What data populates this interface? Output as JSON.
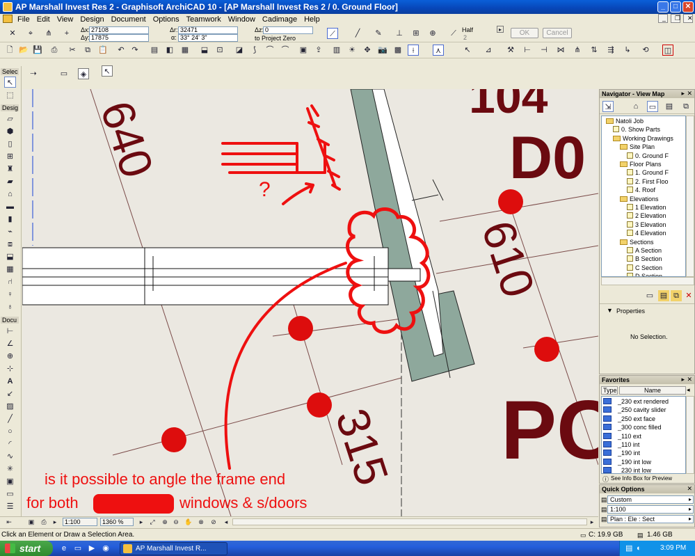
{
  "window": {
    "title": "AP Marshall Invest Res 2 - Graphisoft ArchiCAD 10 - [AP Marshall Invest Res 2 / 0. Ground Floor]",
    "controls": [
      "_",
      "□",
      "✕"
    ]
  },
  "menu": [
    "File",
    "Edit",
    "View",
    "Design",
    "Document",
    "Options",
    "Teamwork",
    "Window",
    "Cadimage",
    "Help"
  ],
  "coords": {
    "dx_label": "Δx:",
    "dx": "27108",
    "dy_label": "Δy:",
    "dy": "17875",
    "dr_label": "Δr:",
    "dr": "32471",
    "da_label": "α:",
    "da": "33° 24' 3\"",
    "dz_label": "Δz:",
    "dz": "0",
    "zero": "to Project Zero",
    "half_label": "Half",
    "half_value": "2",
    "ok": "OK",
    "cancel": "Cancel"
  },
  "toolbox": {
    "select_header": "Selec",
    "design_header": "Desig",
    "document_header": "Docu"
  },
  "canvas": {
    "dims": [
      "640",
      "610",
      "315",
      "104",
      "D0",
      "PC"
    ],
    "question_mark": "?",
    "annotation_line1": "is it possible to angle the frame end",
    "annotation_line2_prefix": "for both",
    "annotation_line2_suffix": "windows & s/doors",
    "colors": {
      "dim_text": "#6b0a10",
      "annotation": "#ee1010",
      "wall": "#8da59b",
      "marker": "#dd0d0d"
    }
  },
  "bottom_controls": {
    "scale": "1:100",
    "zoom": "1360 %"
  },
  "navigator": {
    "title": "Navigator - View Map",
    "tree": [
      {
        "label": "Natoli Job",
        "kind": "root",
        "level": 0
      },
      {
        "label": "0. Show Parts",
        "kind": "doc",
        "level": 1
      },
      {
        "label": "Working Drawings",
        "kind": "folder",
        "level": 1
      },
      {
        "label": "Site Plan",
        "kind": "folder",
        "level": 2
      },
      {
        "label": "0. Ground F",
        "kind": "doc",
        "level": 3
      },
      {
        "label": "Floor Plans",
        "kind": "folder",
        "level": 2
      },
      {
        "label": "1. Ground F",
        "kind": "doc",
        "level": 3
      },
      {
        "label": "2. First Floo",
        "kind": "doc",
        "level": 3
      },
      {
        "label": "4. Roof",
        "kind": "doc",
        "level": 3
      },
      {
        "label": "Elevations",
        "kind": "folder",
        "level": 2
      },
      {
        "label": "1 Elevation",
        "kind": "doc",
        "level": 3
      },
      {
        "label": "2 Elevation",
        "kind": "doc",
        "level": 3
      },
      {
        "label": "3 Elevation",
        "kind": "doc",
        "level": 3
      },
      {
        "label": "4 Elevation",
        "kind": "doc",
        "level": 3
      },
      {
        "label": "Sections",
        "kind": "folder",
        "level": 2
      },
      {
        "label": "A Section",
        "kind": "doc",
        "level": 3
      },
      {
        "label": "B Section",
        "kind": "doc",
        "level": 3
      },
      {
        "label": "C Section",
        "kind": "doc",
        "level": 3
      },
      {
        "label": "D Section",
        "kind": "doc",
        "level": 3
      }
    ],
    "properties_label": "Properties",
    "no_selection": "No Selection."
  },
  "favorites": {
    "title": "Favorites",
    "col_type": "Type",
    "col_name": "Name",
    "items": [
      "_230 ext rendered",
      "_250 cavity slider",
      "_250 ext face",
      "_300 conc filled",
      "_110 ext",
      "_110 int",
      "_190 int",
      "_190 int low",
      "_230 int low"
    ],
    "footer": "See Info Box for Preview"
  },
  "quick_options": {
    "title": "Quick Options",
    "options": [
      "Custom",
      "1:100",
      "Plan : Ele : Sect"
    ]
  },
  "status": {
    "message": "Click an Element or Draw a Selection Area.",
    "disk_c": "C: 19.9 GB",
    "memory": "1.46 GB"
  },
  "taskbar": {
    "start": "start",
    "task": "AP Marshall Invest R...",
    "time": "3:09 PM"
  }
}
